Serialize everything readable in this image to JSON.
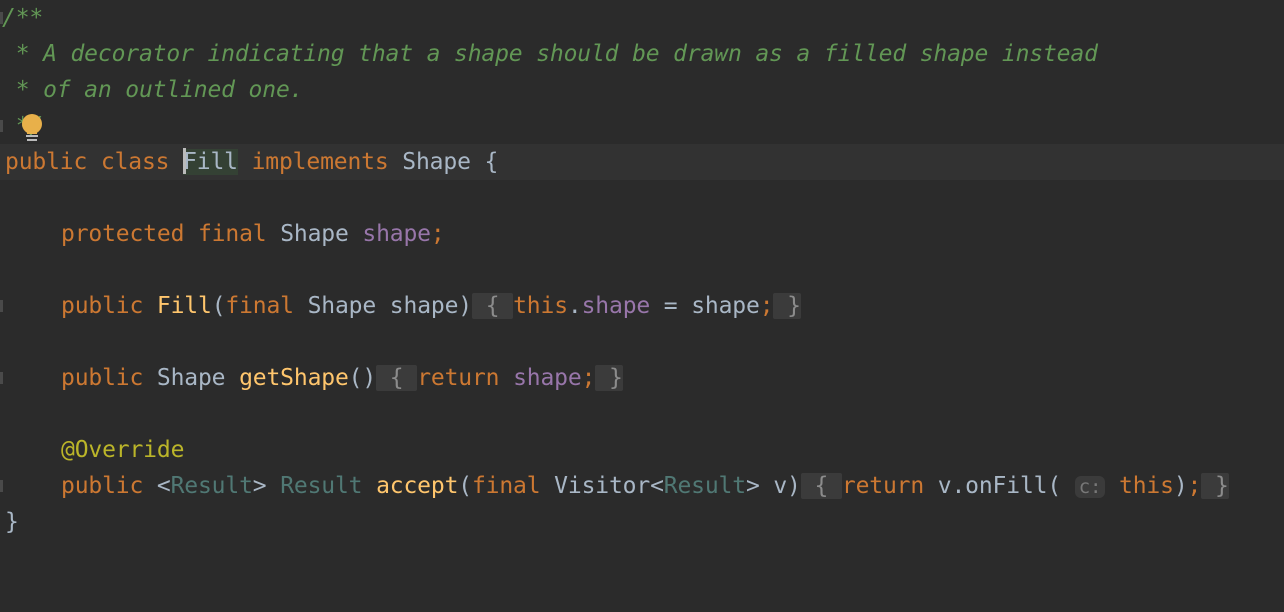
{
  "editor": {
    "language": "java",
    "colors": {
      "background": "#2b2b2b",
      "current_line": "#323232",
      "keyword": "#cc7832",
      "comment": "#629755",
      "field": "#9876aa",
      "method": "#ffc66d",
      "annotation": "#bbb529",
      "type_parameter": "#507874",
      "plain": "#a9b7c6"
    },
    "lines": {
      "l1": {
        "c": "/**"
      },
      "l2": {
        "c": " * A decorator indicating that a shape should be drawn as a filled shape instead"
      },
      "l3": {
        "c": " * of an outlined one."
      },
      "l4": {
        "c": " */"
      },
      "l5": {
        "kw1": "public",
        "kw2": "class",
        "name": "Fill",
        "kw3": "implements",
        "type": "Shape",
        "brace": "{"
      },
      "l7": {
        "kw1": "protected",
        "kw2": "final",
        "type": "Shape",
        "field": "shape",
        "semi": ";"
      },
      "l9": {
        "kw1": "public",
        "name": "Fill",
        "p1": "(",
        "kw2": "final",
        "type": "Shape",
        "param": "shape",
        "p2": ")",
        "fold_open": "{",
        "kw3": "this",
        "dot": ".",
        "field": "shape",
        "assign": " = ",
        "value": "shape",
        "semi": ";",
        "fold_close": "}"
      },
      "l11": {
        "kw1": "public",
        "type": "Shape",
        "name": "getShape",
        "parens": "()",
        "fold_open": "{",
        "kw2": "return",
        "field": "shape",
        "semi": ";",
        "fold_close": "}"
      },
      "l13": {
        "annotation": "@Override"
      },
      "l14": {
        "kw1": "public",
        "lt": "<",
        "tp1": "Result",
        "gt": ">",
        "tp2": "Result",
        "name": "accept",
        "p1": "(",
        "kw2": "final",
        "type": "Visitor",
        "lt2": "<",
        "tp3": "Result",
        "gt2": ">",
        "param": "v)",
        "fold_open": "{",
        "kw3": "return",
        "call": "v.onFill(",
        "hint": "c:",
        "kw4": "this",
        "close": ")",
        "semi": ";",
        "fold_close": "}"
      },
      "l15": {
        "brace": "}"
      }
    },
    "intention_bulb": "lightbulb-icon"
  }
}
